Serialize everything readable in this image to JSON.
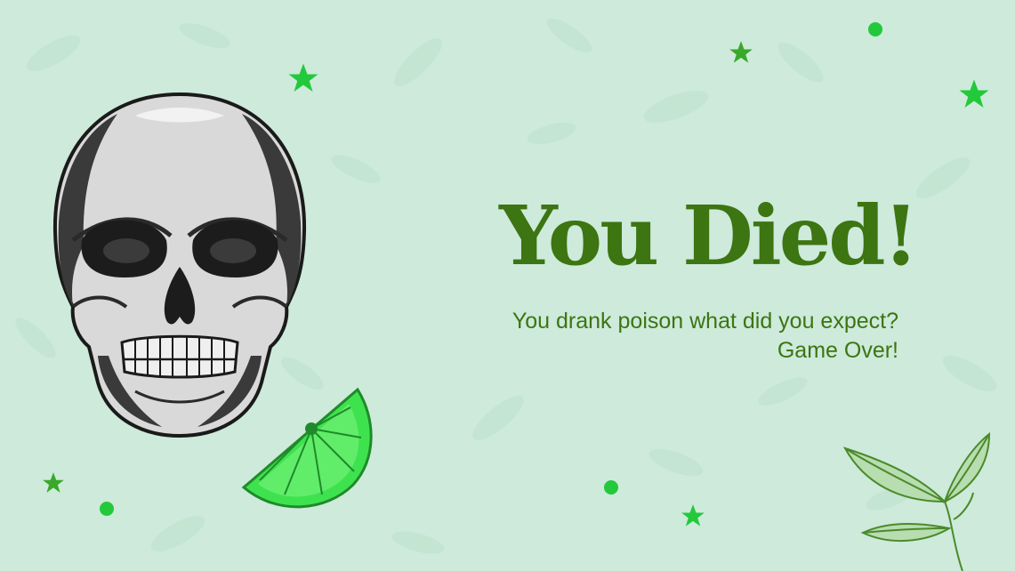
{
  "slide": {
    "title": "You Died!",
    "message_line1": "You drank poison what did you expect?",
    "message_line2": "Game Over!"
  },
  "icons": [
    "skull-illustration",
    "lime-slice-icon",
    "mint-leaf-icon",
    "star-icon",
    "dot-icon"
  ],
  "colors": {
    "background": "#cdeadb",
    "text": "#3c7511",
    "accent_green": "#22c93a",
    "lime": "#3ee24f"
  }
}
